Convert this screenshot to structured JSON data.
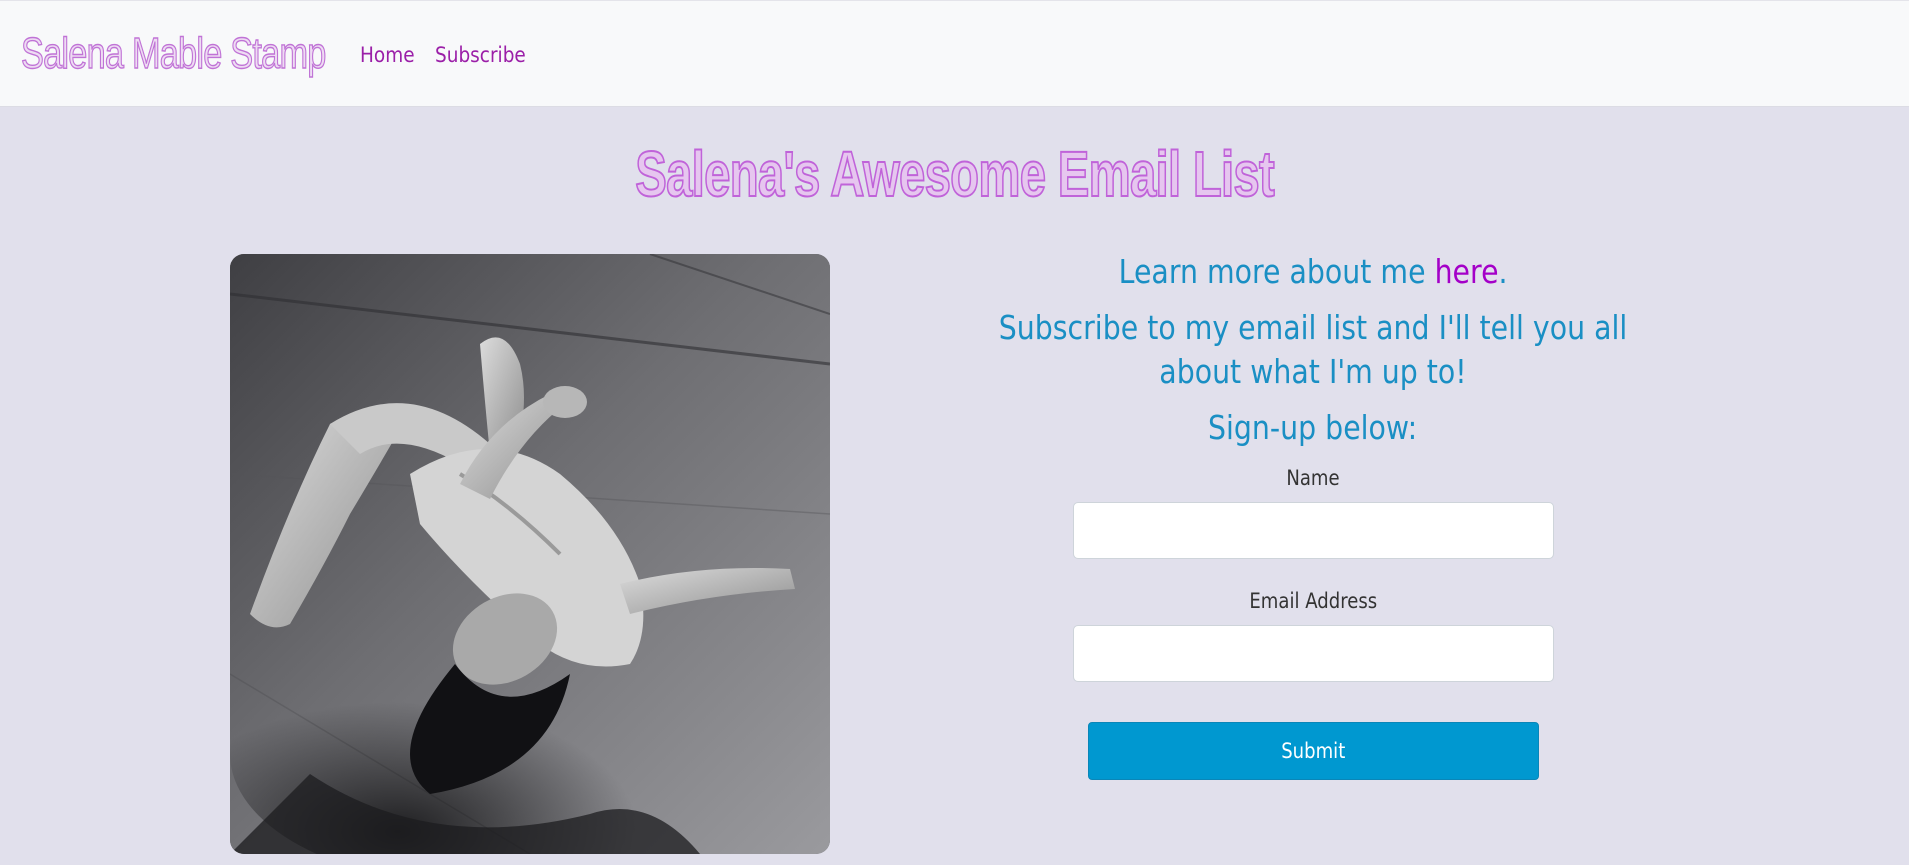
{
  "navbar": {
    "brand": "Salena Mable Stamp",
    "links": [
      {
        "label": "Home"
      },
      {
        "label": "Subscribe"
      }
    ]
  },
  "main": {
    "title": "Salena's Awesome Email List",
    "intro_prefix": "Learn more about me ",
    "intro_link": "here",
    "intro_suffix": ".",
    "subscribe_text": "Subscribe to my email list and I'll tell you all about what I'm up to!",
    "signup_text": "Sign-up below:"
  },
  "form": {
    "name_label": "Name",
    "name_value": "",
    "email_label": "Email Address",
    "email_value": "",
    "submit_label": "Submit"
  },
  "colors": {
    "background": "#e1e0ec",
    "navbar": "#f8f9fa",
    "brand_outline": "#c073d6",
    "link": "#9b1fa8",
    "text_blue": "#1a8fc4",
    "button": "#0098d0"
  }
}
